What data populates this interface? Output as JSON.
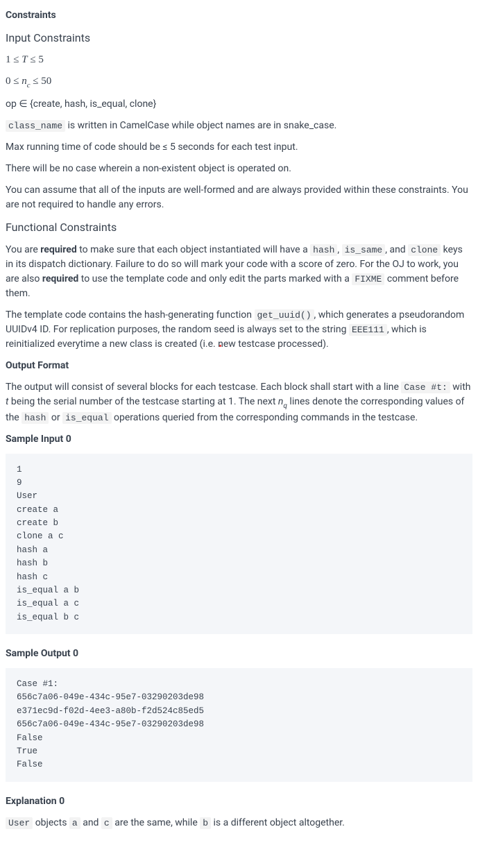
{
  "headings": {
    "constraints": "Constraints",
    "input_constraints": "Input Constraints",
    "functional_constraints": "Functional Constraints",
    "output_format": "Output Format",
    "sample_input_0": "Sample Input 0",
    "sample_output_0": "Sample Output 0",
    "explanation_0": "Explanation 0"
  },
  "input_constraints": {
    "T_range": {
      "low": "1",
      "op1": "≤",
      "var": "T",
      "op2": "≤",
      "high": "5"
    },
    "nc_range": {
      "low": "0",
      "op1": "≤",
      "var": "n",
      "sub": "c",
      "op2": "≤",
      "high": "50"
    },
    "op_set": {
      "prefix": "op ∈ {",
      "items": "create, hash, is_equal, clone",
      "suffix": "}"
    },
    "class_name_note": {
      "code": "class_name",
      "rest": " is written in CamelCase while object names are in snake_case."
    },
    "max_time": "Max running time of code should be ≤ 5 seconds for each test input.",
    "no_missing": "There will be no case wherein a non-existent object is operated on.",
    "well_formed": "You can assume that all of the inputs are well-formed and are always provided within these constraints. You are not required to handle any errors."
  },
  "functional": {
    "para1": {
      "p0": "You are ",
      "required1": "required",
      "p1": " to make sure that each object instantiated will have a ",
      "c_hash": "hash",
      "p2": ", ",
      "c_is_same": "is_same",
      "p3": ", and ",
      "c_clone": "clone",
      "p4": " keys in its dispatch dictionary. Failure to do so will mark your code with a score of zero. For the OJ to work, you are also ",
      "required2": "required",
      "p5": " to use the template code and only edit the parts marked with a ",
      "c_fixme": "FIXME",
      "p6": " comment before them."
    },
    "para2": {
      "p0": "The template code contains the hash-generating function ",
      "c_get_uuid": "get_uuid()",
      "p1": ", which generates a pseudorandom UUIDv4 ID. For replication purposes, the random seed is always set to the string ",
      "c_seed": "EEE111",
      "p2": ", which is reinitialized everytime a new class is created (i.e. new testcase processed)."
    }
  },
  "output_format": {
    "p0": "The output will consist of several blocks for each testcase. Each block shall start with a line ",
    "c_case": "Case #t:",
    "p1": " with ",
    "var_t": "t",
    "p2": " being the serial number of the testcase starting at 1. The next ",
    "var_n": "n",
    "sub_q": "q",
    "p3": " lines denote the corresponding values of the ",
    "c_hash": "hash",
    "p4": " or ",
    "c_is_equal": "is_equal",
    "p5": " operations queried from the corresponding commands in the testcase."
  },
  "sample_input_0": "1\n9\nUser\ncreate a\ncreate b\nclone a c\nhash a\nhash b\nhash c\nis_equal a b\nis_equal a c\nis_equal b c",
  "sample_output_0": "Case #1:\n656c7a06-049e-434c-95e7-03290203de98\ne371ec9d-f02d-4ee3-a80b-f2d524c85ed5\n656c7a06-049e-434c-95e7-03290203de98\nFalse\nTrue\nFalse",
  "explanation_0": {
    "c_user": "User",
    "p1": " objects ",
    "c_a": "a",
    "p2": " and ",
    "c_c": "c",
    "p3": " are the same, while ",
    "c_b": "b",
    "p4": " is a different object altogether."
  }
}
